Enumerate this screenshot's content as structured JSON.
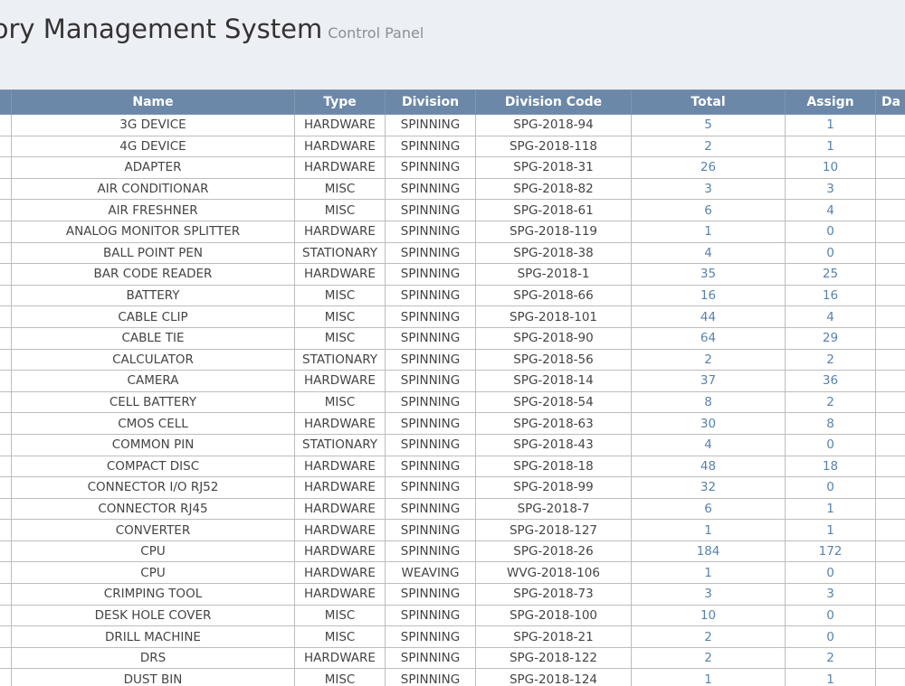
{
  "header": {
    "title": "ntory Management System",
    "subtitle": "Control Panel"
  },
  "table": {
    "columns": [
      "",
      "Name",
      "Type",
      "Division",
      "Division Code",
      "Total",
      "Assign",
      "Da"
    ],
    "rows": [
      {
        "name": "3G DEVICE",
        "type": "HARDWARE",
        "division": "SPINNING",
        "code": "SPG-2018-94",
        "total": "5",
        "assign": "1"
      },
      {
        "name": "4G DEVICE",
        "type": "HARDWARE",
        "division": "SPINNING",
        "code": "SPG-2018-118",
        "total": "2",
        "assign": "1"
      },
      {
        "name": "ADAPTER",
        "type": "HARDWARE",
        "division": "SPINNING",
        "code": "SPG-2018-31",
        "total": "26",
        "assign": "10"
      },
      {
        "name": "AIR CONDITIONAR",
        "type": "MISC",
        "division": "SPINNING",
        "code": "SPG-2018-82",
        "total": "3",
        "assign": "3"
      },
      {
        "name": "AIR FRESHNER",
        "type": "MISC",
        "division": "SPINNING",
        "code": "SPG-2018-61",
        "total": "6",
        "assign": "4"
      },
      {
        "name": "ANALOG MONITOR SPLITTER",
        "type": "HARDWARE",
        "division": "SPINNING",
        "code": "SPG-2018-119",
        "total": "1",
        "assign": "0"
      },
      {
        "name": "BALL POINT PEN",
        "type": "STATIONARY",
        "division": "SPINNING",
        "code": "SPG-2018-38",
        "total": "4",
        "assign": "0"
      },
      {
        "name": "BAR CODE READER",
        "type": "HARDWARE",
        "division": "SPINNING",
        "code": "SPG-2018-1",
        "total": "35",
        "assign": "25"
      },
      {
        "name": "BATTERY",
        "type": "MISC",
        "division": "SPINNING",
        "code": "SPG-2018-66",
        "total": "16",
        "assign": "16"
      },
      {
        "name": "CABLE CLIP",
        "type": "MISC",
        "division": "SPINNING",
        "code": "SPG-2018-101",
        "total": "44",
        "assign": "4"
      },
      {
        "name": "CABLE TIE",
        "type": "MISC",
        "division": "SPINNING",
        "code": "SPG-2018-90",
        "total": "64",
        "assign": "29"
      },
      {
        "name": "CALCULATOR",
        "type": "STATIONARY",
        "division": "SPINNING",
        "code": "SPG-2018-56",
        "total": "2",
        "assign": "2"
      },
      {
        "name": "CAMERA",
        "type": "HARDWARE",
        "division": "SPINNING",
        "code": "SPG-2018-14",
        "total": "37",
        "assign": "36"
      },
      {
        "name": "CELL BATTERY",
        "type": "MISC",
        "division": "SPINNING",
        "code": "SPG-2018-54",
        "total": "8",
        "assign": "2"
      },
      {
        "name": "CMOS CELL",
        "type": "HARDWARE",
        "division": "SPINNING",
        "code": "SPG-2018-63",
        "total": "30",
        "assign": "8"
      },
      {
        "name": "COMMON PIN",
        "type": "STATIONARY",
        "division": "SPINNING",
        "code": "SPG-2018-43",
        "total": "4",
        "assign": "0"
      },
      {
        "name": "COMPACT DISC",
        "type": "HARDWARE",
        "division": "SPINNING",
        "code": "SPG-2018-18",
        "total": "48",
        "assign": "18"
      },
      {
        "name": "CONNECTOR I/O RJ52",
        "type": "HARDWARE",
        "division": "SPINNING",
        "code": "SPG-2018-99",
        "total": "32",
        "assign": "0"
      },
      {
        "name": "CONNECTOR RJ45",
        "type": "HARDWARE",
        "division": "SPINNING",
        "code": "SPG-2018-7",
        "total": "6",
        "assign": "1"
      },
      {
        "name": "CONVERTER",
        "type": "HARDWARE",
        "division": "SPINNING",
        "code": "SPG-2018-127",
        "total": "1",
        "assign": "1"
      },
      {
        "name": "CPU",
        "type": "HARDWARE",
        "division": "SPINNING",
        "code": "SPG-2018-26",
        "total": "184",
        "assign": "172"
      },
      {
        "name": "CPU",
        "type": "HARDWARE",
        "division": "WEAVING",
        "code": "WVG-2018-106",
        "total": "1",
        "assign": "0"
      },
      {
        "name": "CRIMPING TOOL",
        "type": "HARDWARE",
        "division": "SPINNING",
        "code": "SPG-2018-73",
        "total": "3",
        "assign": "3"
      },
      {
        "name": "DESK HOLE COVER",
        "type": "MISC",
        "division": "SPINNING",
        "code": "SPG-2018-100",
        "total": "10",
        "assign": "0"
      },
      {
        "name": "DRILL MACHINE",
        "type": "MISC",
        "division": "SPINNING",
        "code": "SPG-2018-21",
        "total": "2",
        "assign": "0"
      },
      {
        "name": "DRS",
        "type": "HARDWARE",
        "division": "SPINNING",
        "code": "SPG-2018-122",
        "total": "2",
        "assign": "2"
      },
      {
        "name": "DUST BIN",
        "type": "MISC",
        "division": "SPINNING",
        "code": "SPG-2018-124",
        "total": "1",
        "assign": "1"
      }
    ]
  }
}
